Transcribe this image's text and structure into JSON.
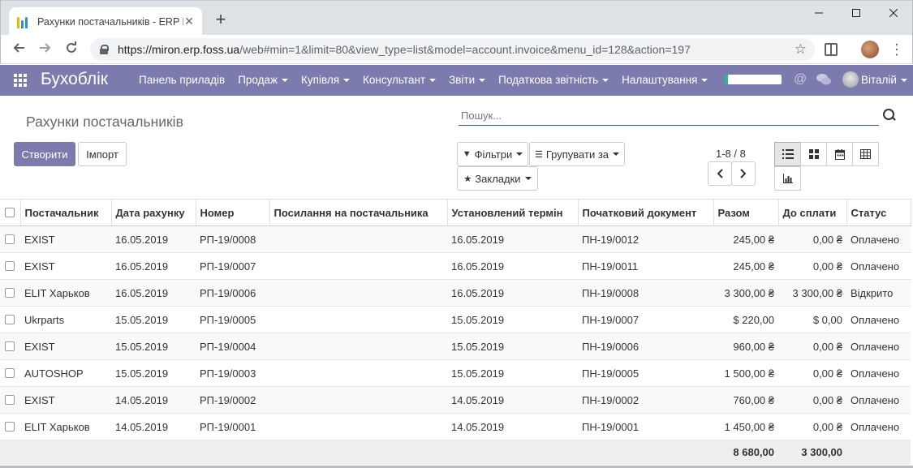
{
  "browser": {
    "tab_title": "Рахунки постачальників - ERP F",
    "url_host": "https://miron.erp.foss.ua",
    "url_path": "/web#min=1&limit=80&view_type=list&model=account.invoice&menu_id=128&action=197"
  },
  "navbar": {
    "brand": "Бухоблік",
    "menu": [
      {
        "label": "Панель приладів",
        "dropdown": false
      },
      {
        "label": "Продаж",
        "dropdown": true
      },
      {
        "label": "Купівля",
        "dropdown": true
      },
      {
        "label": "Консультант",
        "dropdown": true
      },
      {
        "label": "Звіти",
        "dropdown": true
      },
      {
        "label": "Податкова звітність",
        "dropdown": true
      },
      {
        "label": "Налаштування",
        "dropdown": true
      }
    ],
    "progress_fraction": 0.05,
    "user_name": "Віталій",
    "accent": "#7c7bad"
  },
  "control_panel": {
    "breadcrumb": "Рахунки постачальників",
    "search_placeholder": "Пошук...",
    "create_label": "Створити",
    "import_label": "Імпорт",
    "filters_label": "Фільтри",
    "groupby_label": "Групувати за",
    "favorites_label": "Закладки",
    "pager_value": "1-8 / 8"
  },
  "table": {
    "columns": [
      "Постачальник",
      "Дата рахунку",
      "Номер",
      "Посилання на постачальника",
      "Установлений термін",
      "Початковий документ",
      "Разом",
      "До сплати",
      "Статус"
    ],
    "rows": [
      [
        "EXIST",
        "16.05.2019",
        "РП-19/0008",
        "",
        "16.05.2019",
        "ПН-19/0012",
        "245,00 ₴",
        "0,00 ₴",
        "Оплачено"
      ],
      [
        "EXIST",
        "16.05.2019",
        "РП-19/0007",
        "",
        "16.05.2019",
        "ПН-19/0011",
        "245,00 ₴",
        "0,00 ₴",
        "Оплачено"
      ],
      [
        "ELIT Харьков",
        "16.05.2019",
        "РП-19/0006",
        "",
        "16.05.2019",
        "ПН-19/0008",
        "3 300,00 ₴",
        "3 300,00 ₴",
        "Відкрито"
      ],
      [
        "Ukrparts",
        "15.05.2019",
        "РП-19/0005",
        "",
        "15.05.2019",
        "ПН-19/0007",
        "$ 220,00",
        "$ 0,00",
        "Оплачено"
      ],
      [
        "EXIST",
        "15.05.2019",
        "РП-19/0004",
        "",
        "15.05.2019",
        "ПН-19/0006",
        "960,00 ₴",
        "0,00 ₴",
        "Оплачено"
      ],
      [
        "AUTOSHOP",
        "15.05.2019",
        "РП-19/0003",
        "",
        "15.05.2019",
        "ПН-19/0005",
        "1 500,00 ₴",
        "0,00 ₴",
        "Оплачено"
      ],
      [
        "EXIST",
        "14.05.2019",
        "РП-19/0002",
        "",
        "14.05.2019",
        "ПН-19/0002",
        "760,00 ₴",
        "0,00 ₴",
        "Оплачено"
      ],
      [
        "ELIT Харьков",
        "14.05.2019",
        "РП-19/0001",
        "",
        "14.05.2019",
        "ПН-19/0001",
        "1 450,00 ₴",
        "0,00 ₴",
        "Оплачено"
      ]
    ],
    "totals": {
      "total": "8 680,00",
      "due": "3 300,00"
    }
  }
}
